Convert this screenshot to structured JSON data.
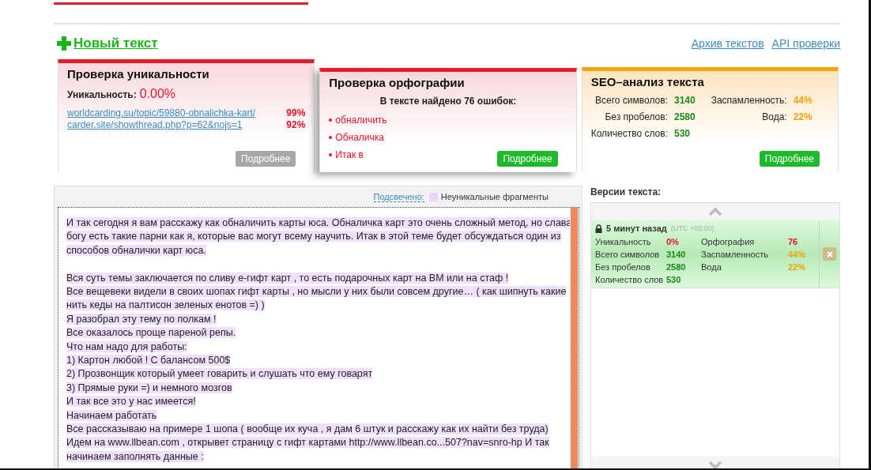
{
  "actions": {
    "new_text": "Новый текст",
    "links": [
      "Архив текстов",
      "API проверки"
    ]
  },
  "uniqueness_card": {
    "title": "Проверка уникальности",
    "label": "Уникальность:",
    "value": "0.00%",
    "sources": [
      {
        "url": "worldcarding.su/topic/59880-obnalichka-kart/",
        "percent": "99%"
      },
      {
        "url": "carder.site/showthread.php?p=62&nojs=1",
        "percent": "92%"
      }
    ],
    "button": {
      "label": "Подробнее",
      "disabled": true
    }
  },
  "spelling_card": {
    "title": "Проверка орфографии",
    "summary": "В тексте найдено 76 ошибок:",
    "errors": [
      "обналичить",
      "Обналичка",
      "Итак в"
    ],
    "button": {
      "label": "Подробнее",
      "disabled": false
    }
  },
  "seo_card": {
    "title": "SEO–анализ текста",
    "stats": [
      {
        "label": "Всего символов:",
        "value": "3140",
        "color": "#1a8a1a"
      },
      {
        "label": "Заспамленность:",
        "value": "44%",
        "color": "#f5a000"
      },
      {
        "label": "Без пробелов:",
        "value": "2580",
        "color": "#1a8a1a"
      },
      {
        "label": "Вода:",
        "value": "22%",
        "color": "#f5a000"
      },
      {
        "label": "Количество слов:",
        "value": "530",
        "color": "#1a8a1a"
      }
    ],
    "button": {
      "label": "Подробнее",
      "disabled": false
    }
  },
  "editor": {
    "legend_link": "Подсвечено:",
    "legend": "Неуникальные фрагменты",
    "paragraphs": [
      [
        "И так сегодня я вам расскажу как обналичить карты юса. Обналичка карт это очень сложный метод, но слава",
        "богу есть такие парни как я, которые вас могут всему научить. Итак в этой теме будет обсуждаться один из",
        "способов обналички карт юса."
      ],
      [
        "Вся суть темы заключается по сливу е-гифт карт , то есть подарочных карт на ВМ или на стаф !",
        "Все вещевеки видели в своих шопах гифт карты , но мысли у них были совсем другие… ( как шипнуть какие",
        "нить кеды на палтисон зеленых енотов =) )",
        "Я разобрал эту тему по полкам !",
        "Все оказалось проще пареной репы.",
        "Что нам надо для работы:",
        "1) Картон любой ! С балансом 500$",
        "2) Прозвонщик который умеет говарить и слушать что ему говарят",
        "3) Прямые руки =) и немного мозгов",
        "И так все это у нас имеется!",
        "Начинаем работать",
        "Все рассказываю на примере 1 шопа ( вообще их куча , я дам 6 штук и расскажу как их найти без труда)",
        "Идем на www.llbean.com , открывет страницу с гифт картами http://www.llbean.co...507?nav=snro-hp И так",
        "начинаем заполнять данные :"
      ]
    ]
  },
  "versions": {
    "title": "Версии текста:",
    "items": [
      {
        "time": "5 минут назад",
        "timezone": "(UTC +03:00)",
        "selected": true,
        "stats": [
          {
            "label": "Уникальность",
            "value": "0%",
            "color": "#e8102a"
          },
          {
            "label": "Орфография",
            "value": "76",
            "color": "#e8102a"
          },
          {
            "label": "Всего символов",
            "value": "3140",
            "color": "#1a8a1a"
          },
          {
            "label": "Заспамленность",
            "value": "44%",
            "color": "#f5a000"
          },
          {
            "label": "Без пробелов",
            "value": "2580",
            "color": "#1a8a1a"
          },
          {
            "label": "Вода",
            "value": "22%",
            "color": "#f5a000"
          },
          {
            "label": "Количество слов",
            "value": "530",
            "color": "#1a8a1a"
          }
        ]
      }
    ]
  }
}
